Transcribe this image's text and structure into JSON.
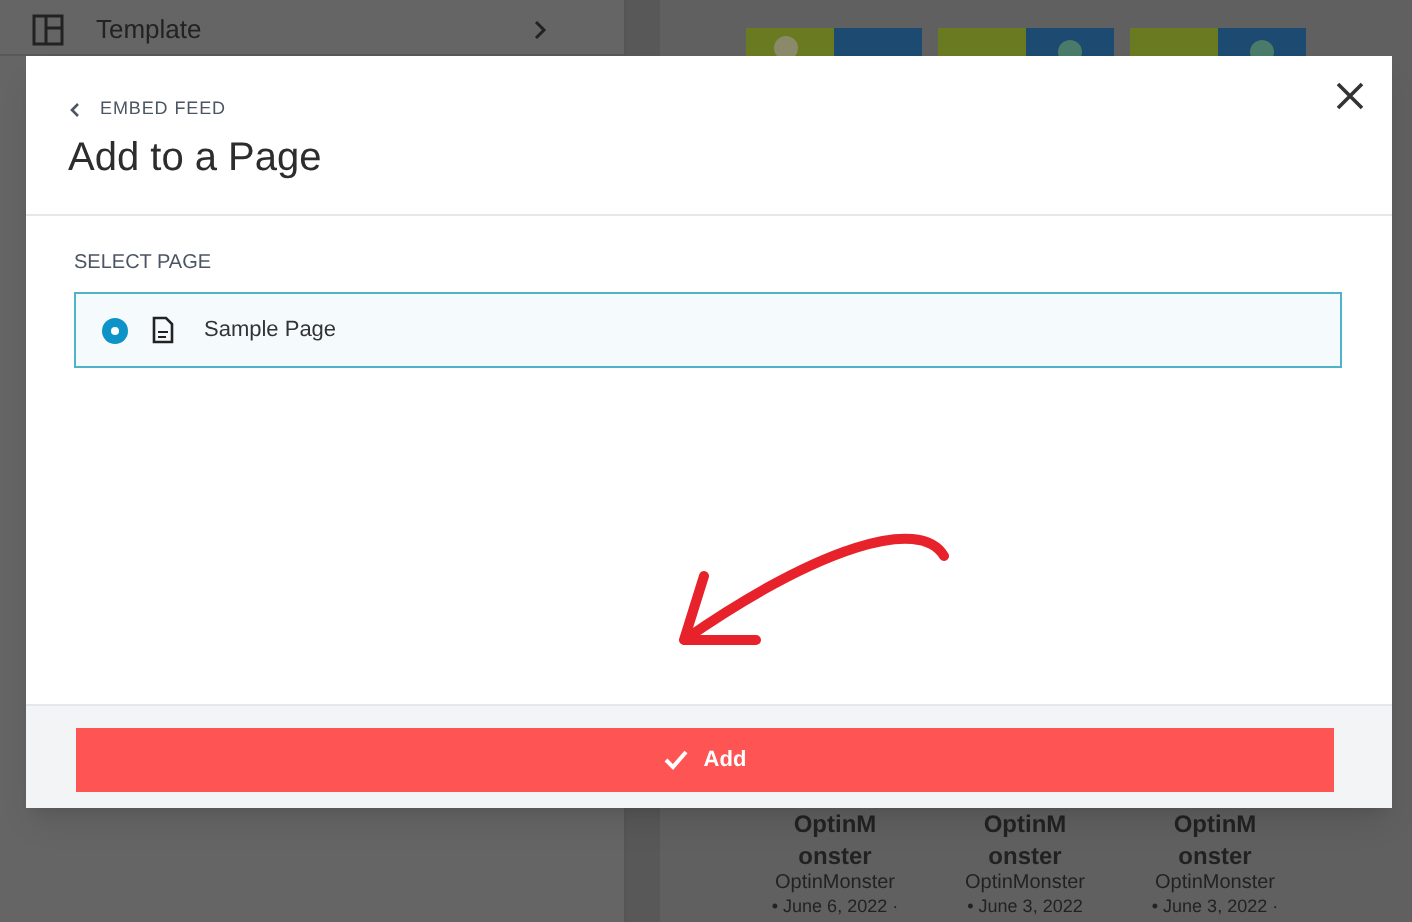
{
  "background": {
    "sidebar_item": {
      "label": "Template"
    },
    "posts": [
      {
        "title": "OptinM onster",
        "author": "OptinMonster",
        "date": "• June 6, 2022 ·"
      },
      {
        "title": "OptinM onster",
        "author": "OptinMonster",
        "date": "• June 3, 2022"
      },
      {
        "title": "OptinM onster",
        "author": "OptinMonster",
        "date": "• June 3, 2022 ·"
      }
    ]
  },
  "modal": {
    "back_link": "EMBED FEED",
    "title": "Add to a Page",
    "section_label": "SELECT PAGE",
    "pages": [
      {
        "label": "Sample Page",
        "selected": true
      }
    ],
    "button": {
      "label": "Add"
    }
  }
}
